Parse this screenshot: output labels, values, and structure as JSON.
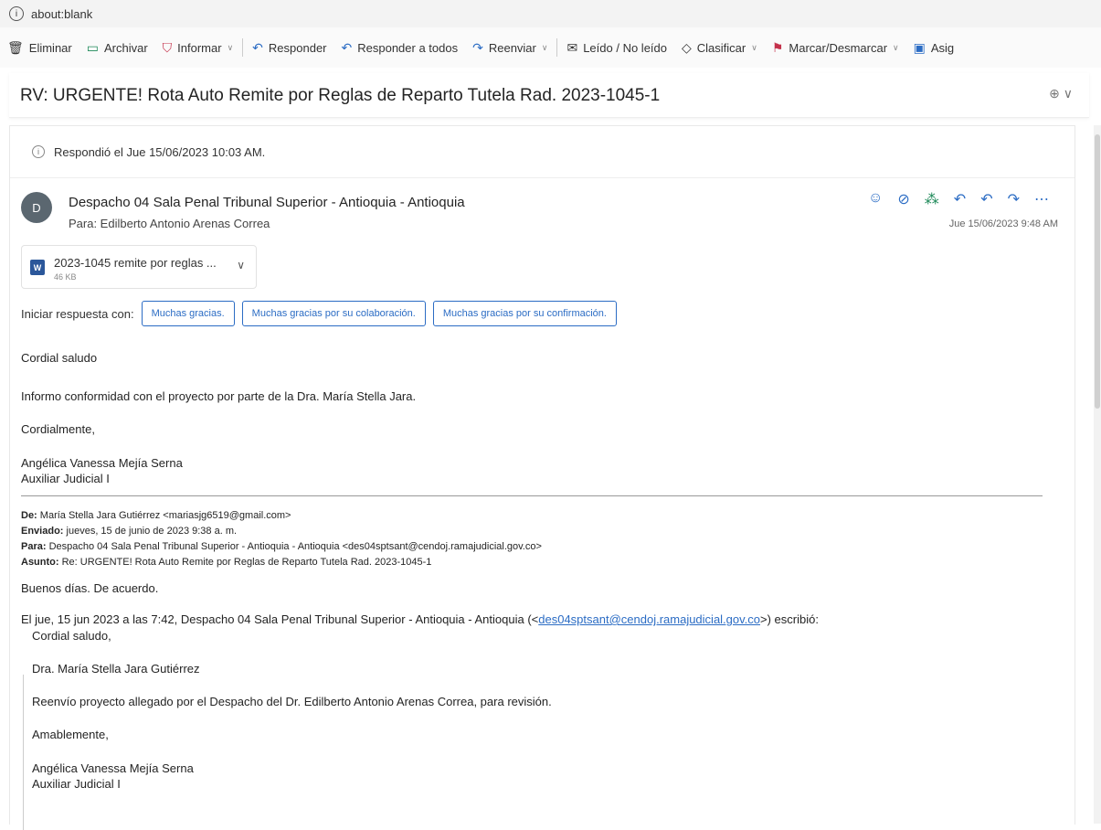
{
  "address": {
    "url": "about:blank"
  },
  "toolbar": {
    "delete": "Eliminar",
    "archive": "Archivar",
    "report": "Informar",
    "reply": "Responder",
    "reply_all": "Responder a todos",
    "forward": "Reenviar",
    "read_unread": "Leído / No leído",
    "categorize": "Clasificar",
    "flag": "Marcar/Desmarcar",
    "assign": "Asig"
  },
  "subject": "RV: URGENTE! Rota Auto Remite por Reglas de Reparto Tutela Rad. 2023-1045-1",
  "reply_note": "Respondió el Jue 15/06/2023 10:03 AM.",
  "message": {
    "avatar_initial": "D",
    "sender": "Despacho 04 Sala Penal Tribunal Superior - Antioquia - Antioquia",
    "to": "Para:  Edilberto Antonio Arenas Correa",
    "date": "Jue 15/06/2023 9:48 AM",
    "attachment": {
      "name": "2023-1045 remite por reglas ...",
      "size": "46 KB"
    },
    "quick_reply": {
      "label": "Iniciar respuesta con:",
      "options": [
        "Muchas gracias.",
        "Muchas gracias por su colaboración.",
        "Muchas gracias por su confirmación."
      ]
    },
    "body": {
      "greeting": "Cordial saludo",
      "line1": "Informo conformidad con el proyecto por parte de la Dra. María Stella Jara.",
      "closing": "Cordialmente,",
      "sig_name": "Angélica Vanessa Mejía Serna",
      "sig_title": "Auxiliar Judicial I"
    },
    "forwarded": {
      "from_label": "De:",
      "from": "María Stella Jara Gutiérrez <mariasjg6519@gmail.com>",
      "sent_label": "Enviado:",
      "sent": "jueves, 15 de junio de 2023 9:38 a. m.",
      "to_label": "Para:",
      "to": "Despacho 04 Sala Penal Tribunal Superior - Antioquia - Antioquia <des04sptsant@cendoj.ramajudicial.gov.co>",
      "subject_label": "Asunto:",
      "subject": "Re: URGENTE! Rota Auto Remite por Reglas de Reparto Tutela Rad. 2023-1045-1",
      "reply": "Buenos días. De acuerdo.",
      "wrote_prefix": "El jue, 15 jun 2023 a las 7:42, Despacho 04 Sala Penal Tribunal Superior - Antioquia - Antioquia (<",
      "wrote_link": "des04sptsant@cendoj.ramajudicial.gov.co",
      "wrote_suffix": ">) escribió:"
    },
    "quoted": {
      "greeting": "Cordial saludo,",
      "addressee": "Dra. María Stella Jara Gutiérrez",
      "text": "Reenvío proyecto allegado por el Despacho del Dr. Edilberto Antonio Arenas Correa, para revisión.",
      "closing": "Amablemente,",
      "sig_name": "Angélica Vanessa Mejía Serna",
      "sig_title": "Auxiliar Judicial I"
    }
  },
  "icons": [
    "info-icon",
    "trash-icon",
    "archive-icon",
    "shield-icon",
    "reply-icon",
    "reply-all-icon",
    "forward-icon",
    "envelope-icon",
    "tag-icon",
    "flag-icon",
    "assign-icon",
    "zoom-icon",
    "emoji-icon",
    "immersive-icon",
    "apps-icon",
    "more-icon",
    "word-file-icon",
    "chevron-down-icon"
  ],
  "colors": {
    "accent": "#2b6cc4",
    "word": "#2b579a",
    "flag": "#c4314b"
  }
}
